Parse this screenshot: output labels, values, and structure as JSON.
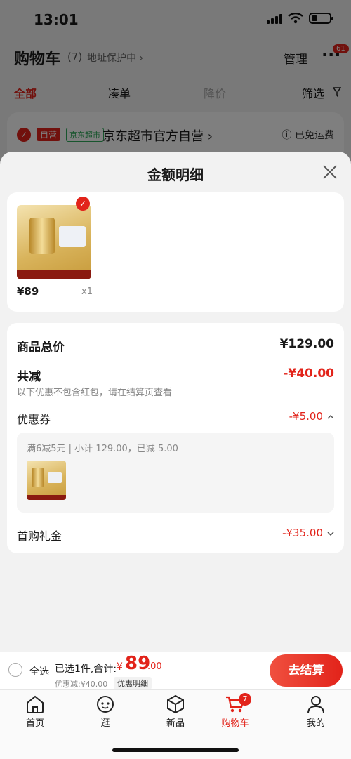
{
  "status": {
    "time": "13:01"
  },
  "cart": {
    "title": "购物车",
    "count": "(7)",
    "address": "地址保护中 ›",
    "manage": "管理",
    "more": "···",
    "more_badge": "61"
  },
  "filters": {
    "all": "全部",
    "combine": "凑单",
    "price_drop": "降价",
    "screen": "筛选"
  },
  "store": {
    "self_tag": "自营",
    "market_tag": "京东超市",
    "name": "京东超市官方自营 ›",
    "shipping": "ⓘ 已免运费"
  },
  "sheet": {
    "title": "金额明细",
    "product": {
      "price": "¥89",
      "qty": "x1"
    },
    "subtotal": {
      "label": "商品总价",
      "amount": "¥129.00"
    },
    "reduction": {
      "label": "共减",
      "amount": "-¥40.00",
      "note": "以下优惠不包含红包，请在结算页查看"
    },
    "coupon": {
      "label": "优惠券",
      "amount": "-¥5.00",
      "detail": "满6减5元 | 小计 129.00，已减 5.00"
    },
    "first_gift": {
      "label": "首购礼金",
      "amount": "-¥35.00"
    }
  },
  "checkout": {
    "select_all": "全选",
    "selected": "已选1件,合计:",
    "symbol": "¥",
    "total_int": "89",
    "total_dec": ".00",
    "discount": "优惠减:¥40.00",
    "detail_link": "优惠明细",
    "button": "去结算"
  },
  "tabbar": {
    "items": [
      {
        "label": "首页"
      },
      {
        "label": "逛"
      },
      {
        "label": "新品"
      },
      {
        "label": "购物车",
        "badge": "7"
      },
      {
        "label": "我的"
      }
    ]
  },
  "colors": {
    "accent": "#e2231a",
    "green": "#2eaa5a"
  }
}
